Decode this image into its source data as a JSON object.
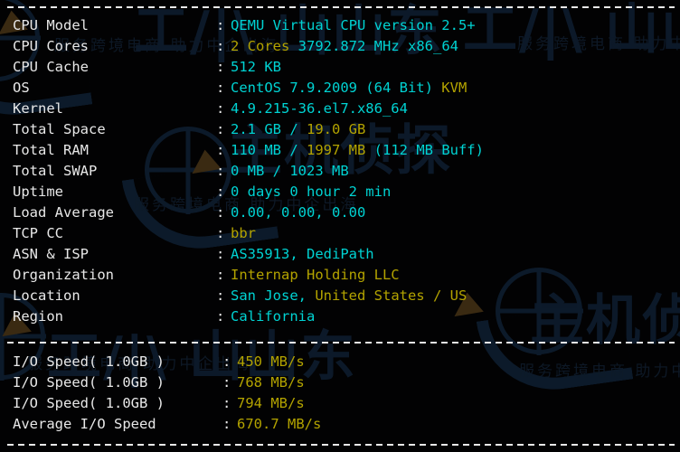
{
  "terminal": {
    "separator_label": "dashed-separator",
    "colon": ":",
    "info_rows": [
      {
        "label": "CPU Model",
        "segments": [
          {
            "text": "QEMU Virtual CPU version 2.5+",
            "color": "cyan"
          }
        ]
      },
      {
        "label": "CPU Cores",
        "segments": [
          {
            "text": "2",
            "color": "yellow"
          },
          {
            "text": " Cores",
            "color": "yellow"
          },
          {
            "text": " 3792.872 MHz x86_64",
            "color": "cyan"
          }
        ]
      },
      {
        "label": "CPU Cache",
        "segments": [
          {
            "text": "512 KB",
            "color": "cyan"
          }
        ]
      },
      {
        "label": "OS",
        "segments": [
          {
            "text": "CentOS 7.9.2009 (64 Bit) ",
            "color": "cyan"
          },
          {
            "text": "KVM",
            "color": "yellow"
          }
        ]
      },
      {
        "label": "Kernel",
        "segments": [
          {
            "text": "4.9.215-36.el7.x86_64",
            "color": "cyan"
          }
        ]
      },
      {
        "label": "Total Space",
        "segments": [
          {
            "text": "2.1 GB ",
            "color": "cyan"
          },
          {
            "text": "/",
            "color": "cyan"
          },
          {
            "text": " 19.0 GB",
            "color": "yellow"
          }
        ]
      },
      {
        "label": "Total RAM",
        "segments": [
          {
            "text": "110 MB ",
            "color": "cyan"
          },
          {
            "text": "/",
            "color": "cyan"
          },
          {
            "text": " 1997 MB",
            "color": "yellow"
          },
          {
            "text": " (112 MB Buff)",
            "color": "cyan"
          }
        ]
      },
      {
        "label": "Total SWAP",
        "segments": [
          {
            "text": "0 MB / 1023 MB",
            "color": "cyan"
          }
        ]
      },
      {
        "label": "Uptime",
        "segments": [
          {
            "text": "0 days 0 hour 2 min",
            "color": "cyan"
          }
        ]
      },
      {
        "label": "Load Average",
        "segments": [
          {
            "text": "0.00, 0.00, 0.00",
            "color": "cyan"
          }
        ]
      },
      {
        "label": "TCP CC",
        "segments": [
          {
            "text": "bbr",
            "color": "yellow"
          }
        ]
      },
      {
        "label": "ASN & ISP",
        "segments": [
          {
            "text": "AS35913, DediPath",
            "color": "cyan"
          }
        ]
      },
      {
        "label": "Organization",
        "segments": [
          {
            "text": "Internap Holding LLC",
            "color": "yellow"
          }
        ]
      },
      {
        "label": "Location",
        "segments": [
          {
            "text": "San Jose, ",
            "color": "cyan"
          },
          {
            "text": "United States / US",
            "color": "yellow"
          }
        ]
      },
      {
        "label": "Region",
        "segments": [
          {
            "text": "California",
            "color": "cyan"
          }
        ]
      }
    ],
    "io_rows": [
      {
        "label": "I/O Speed( 1.0GB )",
        "segments": [
          {
            "text": "450 MB/s",
            "color": "yellow"
          }
        ]
      },
      {
        "label": "I/O Speed( 1.0GB )",
        "segments": [
          {
            "text": "768 MB/s",
            "color": "yellow"
          }
        ]
      },
      {
        "label": "I/O Speed( 1.0GB )",
        "segments": [
          {
            "text": "794 MB/s",
            "color": "yellow"
          }
        ]
      },
      {
        "label": "Average I/O Speed",
        "segments": [
          {
            "text": "670.7 MB/s",
            "color": "yellow"
          }
        ]
      }
    ]
  },
  "watermarks": {
    "brand_cn": "主机侦探",
    "tagline_cn": "服务跨境电商 助力中企出海",
    "logo_cn": "工门\\N山山东"
  },
  "colors": {
    "background": "#020203",
    "label": "#e8e8e8",
    "value_cyan": "#00d3d3",
    "value_yellow": "#b3a300",
    "watermark": "#0d1b2c"
  }
}
